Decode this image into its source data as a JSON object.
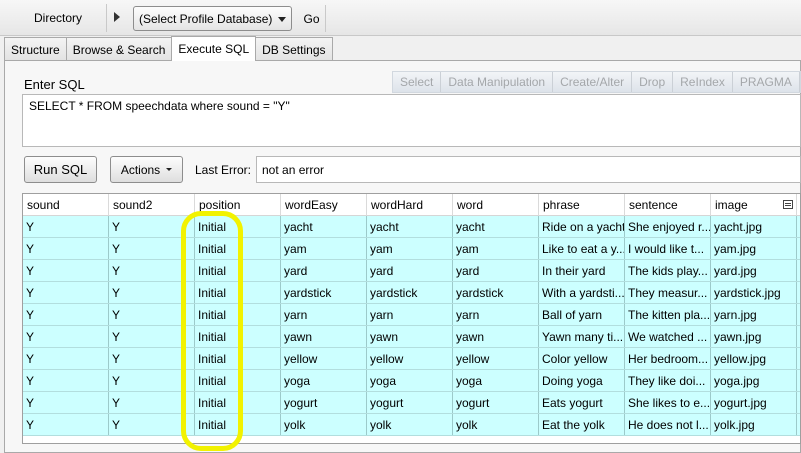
{
  "topbar": {
    "directory_label": "Directory",
    "profile_select_value": "(Select Profile Database)",
    "go_label": "Go"
  },
  "tabs": [
    {
      "label": "Structure"
    },
    {
      "label": "Browse & Search"
    },
    {
      "label": "Execute SQL"
    },
    {
      "label": "DB Settings"
    }
  ],
  "active_tab": "Execute SQL",
  "sql": {
    "label": "Enter SQL",
    "query": "SELECT * FROM speechdata where sound = \"Y\"",
    "toolbar": [
      "Select",
      "Data Manipulation",
      "Create/Alter",
      "Drop",
      "ReIndex",
      "PRAGMA"
    ]
  },
  "actions": {
    "run_label": "Run SQL",
    "actions_label": "Actions",
    "last_error_label": "Last Error:",
    "last_error_value": "not an error"
  },
  "grid": {
    "columns": [
      "sound",
      "sound2",
      "position",
      "wordEasy",
      "wordHard",
      "word",
      "phrase",
      "sentence",
      "image"
    ],
    "rows": [
      [
        "Y",
        "Y",
        "Initial",
        "yacht",
        "yacht",
        "yacht",
        "Ride on a yacht",
        "She enjoyed r...",
        "yacht.jpg"
      ],
      [
        "Y",
        "Y",
        "Initial",
        "yam",
        "yam",
        "yam",
        "Like to eat a y...",
        "I would like t...",
        "yam.jpg"
      ],
      [
        "Y",
        "Y",
        "Initial",
        "yard",
        "yard",
        "yard",
        "In their yard",
        "The kids play...",
        "yard.jpg"
      ],
      [
        "Y",
        "Y",
        "Initial",
        "yardstick",
        "yardstick",
        "yardstick",
        "With a yardsti...",
        "They measur...",
        "yardstick.jpg"
      ],
      [
        "Y",
        "Y",
        "Initial",
        "yarn",
        "yarn",
        "yarn",
        "Ball of yarn",
        "The kitten pla...",
        "yarn.jpg"
      ],
      [
        "Y",
        "Y",
        "Initial",
        "yawn",
        "yawn",
        "yawn",
        "Yawn many ti...",
        "We watched ...",
        "yawn.jpg"
      ],
      [
        "Y",
        "Y",
        "Initial",
        "yellow",
        "yellow",
        "yellow",
        "Color yellow",
        "Her bedroom...",
        "yellow.jpg"
      ],
      [
        "Y",
        "Y",
        "Initial",
        "yoga",
        "yoga",
        "yoga",
        "Doing yoga",
        "They like doi...",
        "yoga.jpg"
      ],
      [
        "Y",
        "Y",
        "Initial",
        "yogurt",
        "yogurt",
        "yogurt",
        "Eats yogurt",
        "She likes to e...",
        "yogurt.jpg"
      ],
      [
        "Y",
        "Y",
        "Initial",
        "yolk",
        "yolk",
        "yolk",
        "Eat the yolk",
        "He does not l...",
        "yolk.jpg"
      ]
    ]
  },
  "colors": {
    "row_background": "#ccffff",
    "highlight": "#f2f200"
  }
}
